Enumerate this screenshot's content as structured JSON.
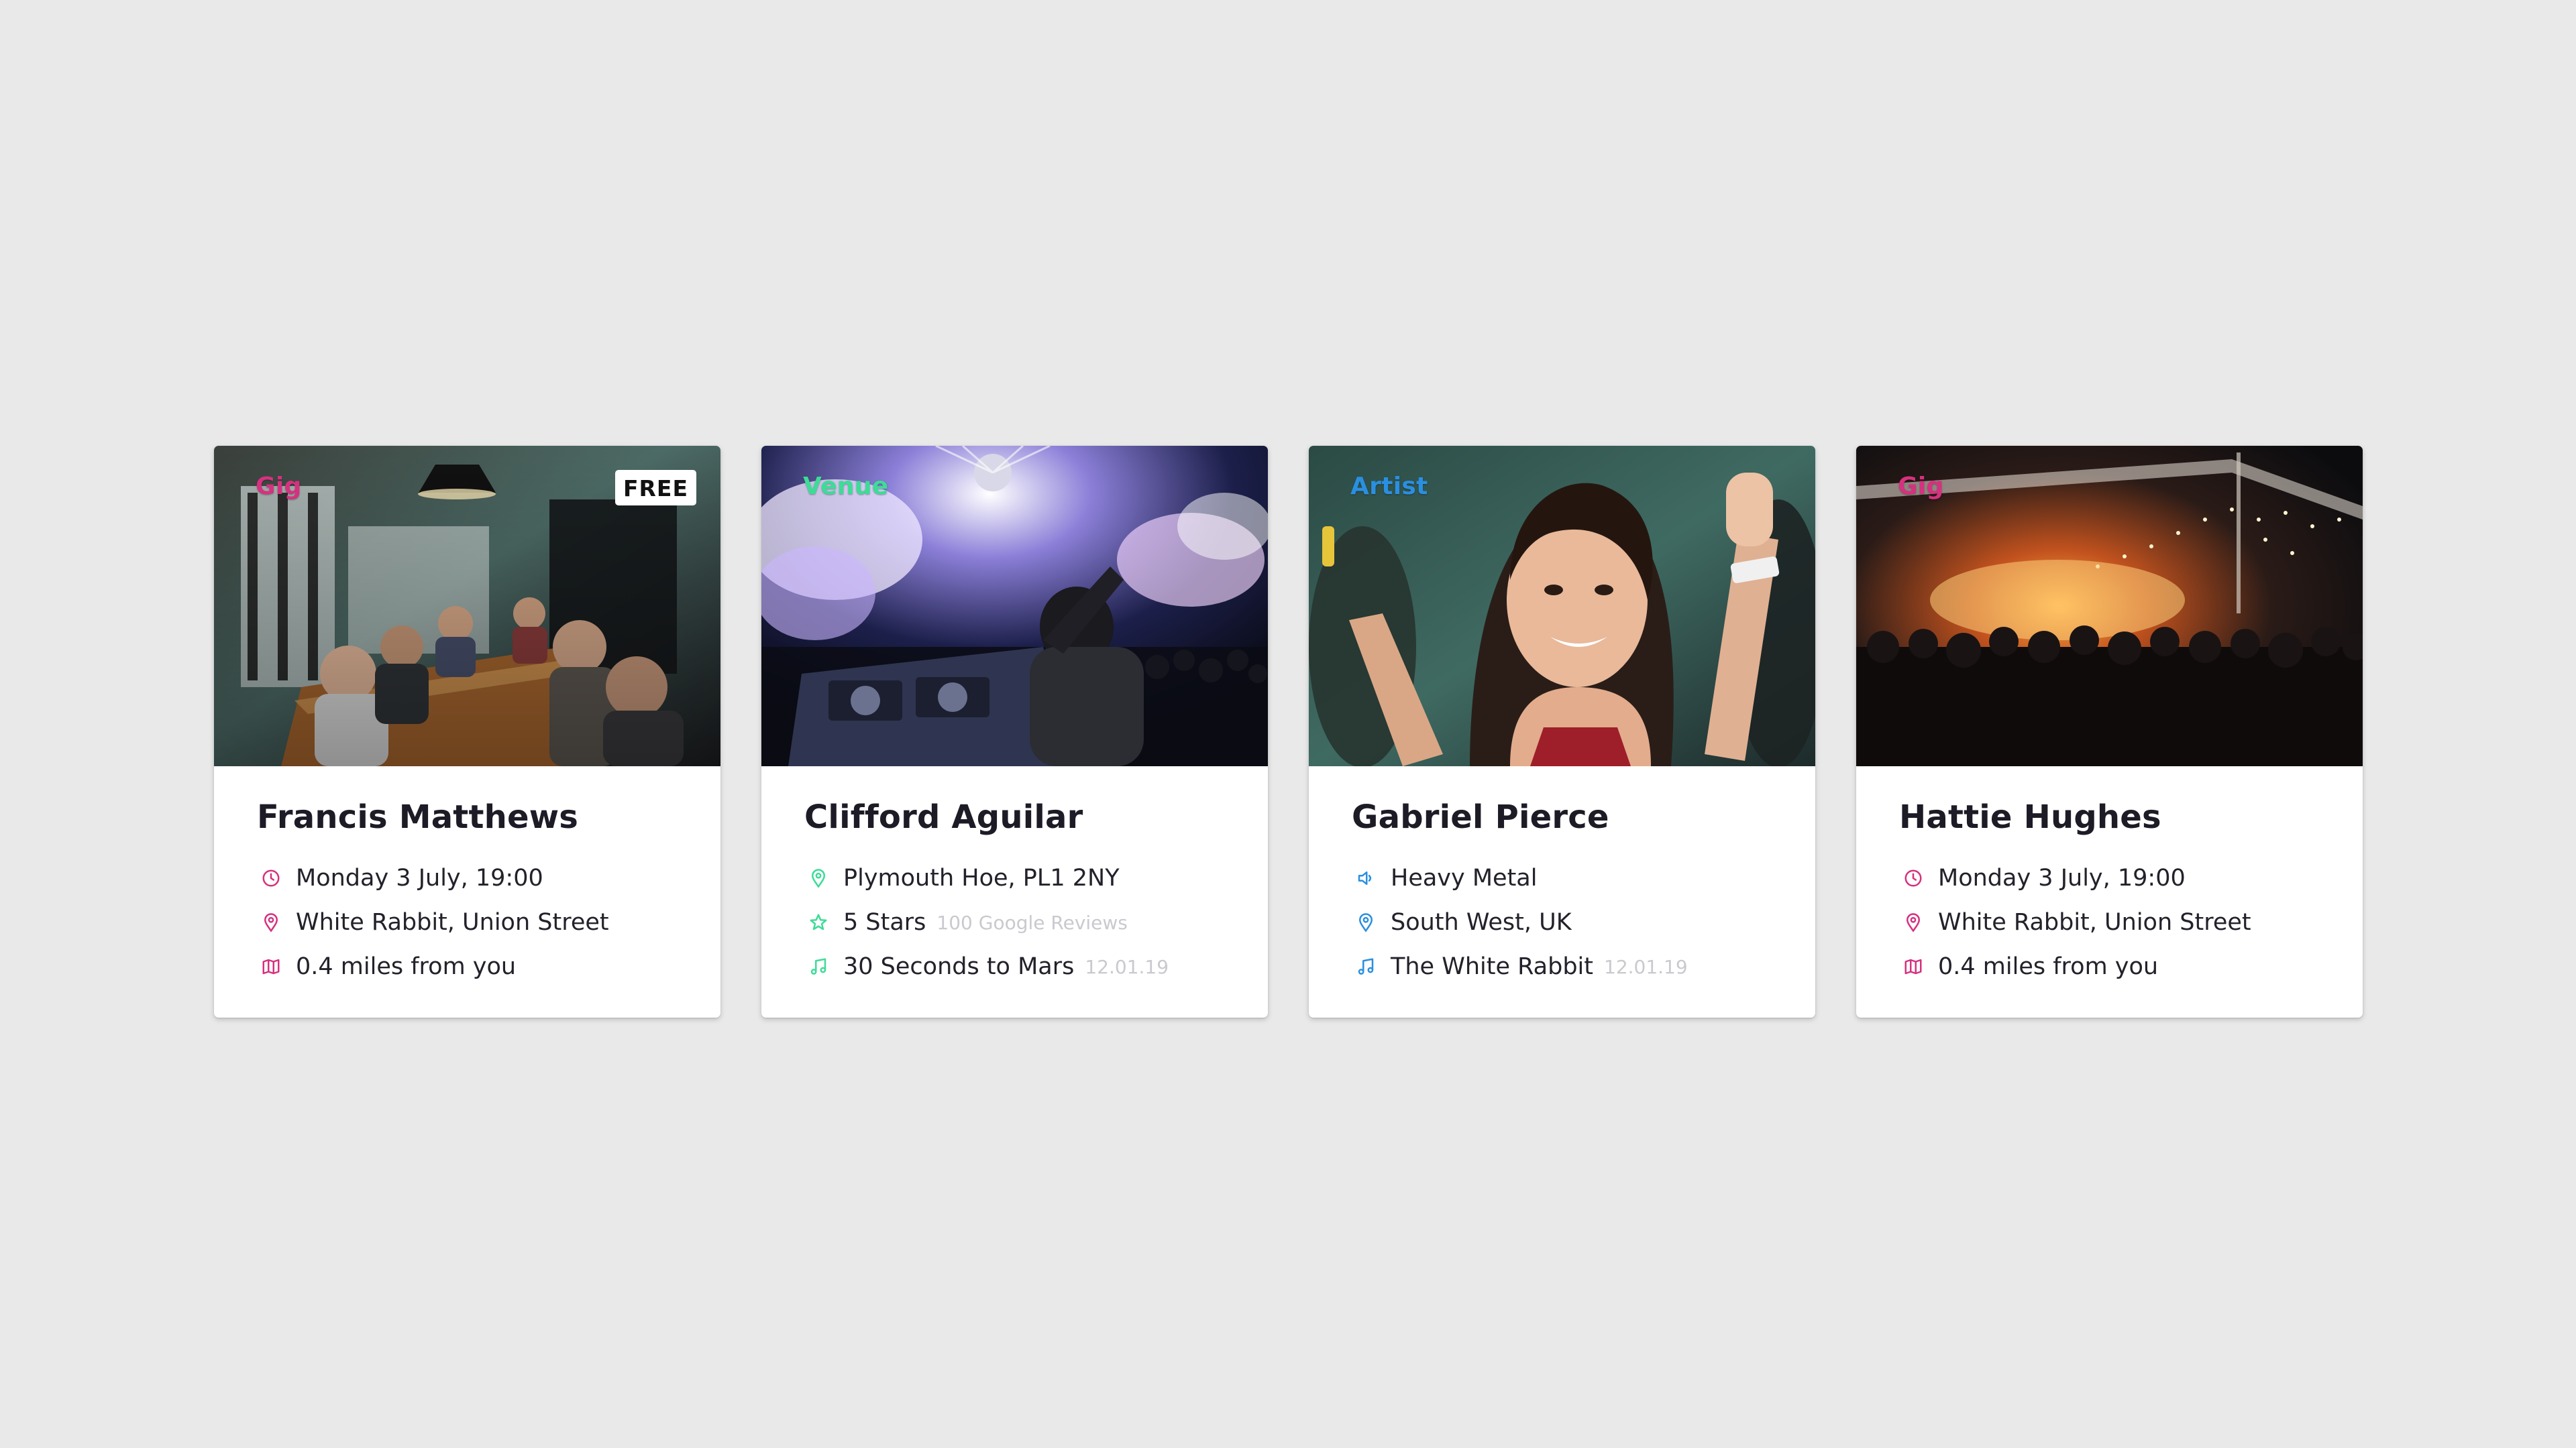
{
  "colors": {
    "background": "#e9e9e9",
    "gig_accent": "#d6317f",
    "venue_accent": "#3ddc97",
    "artist_accent": "#2a8fe0",
    "muted_text": "#c9c9cf"
  },
  "cards": [
    {
      "category": "Gig",
      "badge": "FREE",
      "title": "Francis Matthews",
      "rows": [
        {
          "icon": "clock-icon",
          "text": "Monday 3 July, 19:00",
          "extra": ""
        },
        {
          "icon": "location-pin-icon",
          "text": "White Rabbit, Union Street",
          "extra": ""
        },
        {
          "icon": "map-icon",
          "text": "0.4 miles from you",
          "extra": ""
        }
      ]
    },
    {
      "category": "Venue",
      "badge": "",
      "title": "Clifford Aguilar",
      "rows": [
        {
          "icon": "location-pin-icon",
          "text": "Plymouth Hoe, PL1 2NY",
          "extra": ""
        },
        {
          "icon": "star-icon",
          "text": "5 Stars",
          "extra": "100 Google Reviews"
        },
        {
          "icon": "music-note-icon",
          "text": "30 Seconds to Mars",
          "extra": "12.01.19"
        }
      ]
    },
    {
      "category": "Artist",
      "badge": "",
      "title": "Gabriel Pierce",
      "rows": [
        {
          "icon": "speaker-icon",
          "text": "Heavy Metal",
          "extra": ""
        },
        {
          "icon": "location-pin-icon",
          "text": "South West, UK",
          "extra": ""
        },
        {
          "icon": "music-note-icon",
          "text": "The White Rabbit",
          "extra": "12.01.19"
        }
      ]
    },
    {
      "category": "Gig",
      "badge": "",
      "title": "Hattie Hughes",
      "rows": [
        {
          "icon": "clock-icon",
          "text": "Monday 3 July, 19:00",
          "extra": ""
        },
        {
          "icon": "location-pin-icon",
          "text": "White Rabbit, Union Street",
          "extra": ""
        },
        {
          "icon": "map-icon",
          "text": "0.4 miles from you",
          "extra": ""
        }
      ]
    }
  ]
}
